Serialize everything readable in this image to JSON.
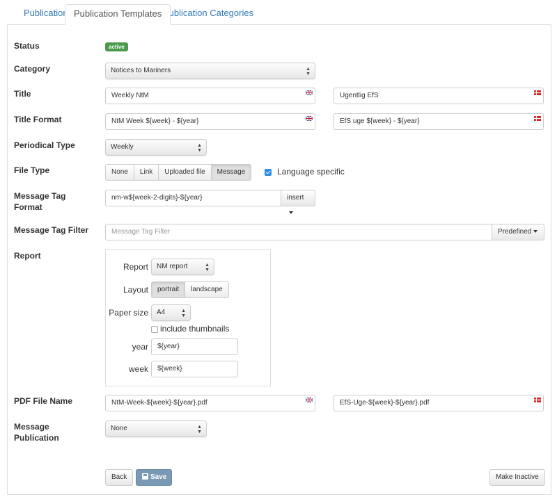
{
  "tabs": [
    {
      "label": "Publications",
      "active": false
    },
    {
      "label": "Publication Templates",
      "active": true
    },
    {
      "label": "Publication Categories",
      "active": false
    }
  ],
  "form": {
    "status": {
      "label": "Status",
      "badge": "active",
      "badge_color": "#4c9a4c"
    },
    "category": {
      "label": "Category",
      "value": "Notices to Mariners"
    },
    "title": {
      "label": "Title",
      "en": "Weekly NtM",
      "da": "Ugentlig EfS"
    },
    "title_format": {
      "label": "Title Format",
      "en": "NtM Week ${week} - ${year}",
      "da": "EfS uge ${week} - ${year}"
    },
    "periodical_type": {
      "label": "Periodical Type",
      "value": "Weekly"
    },
    "file_type": {
      "label": "File Type",
      "options": [
        "None",
        "Link",
        "Uploaded file",
        "Message"
      ],
      "selected": "Message",
      "language_specific_label": "Language specific",
      "language_specific_checked": true
    },
    "message_tag_format": {
      "label_line1": "Message Tag",
      "label_line2": "Format",
      "value": "nm-w${week-2-digits}-${year}",
      "insert_label": "insert"
    },
    "message_tag_filter": {
      "label": "Message Tag Filter",
      "placeholder": "Message Tag Filter",
      "predefined_label": "Predefined"
    },
    "report": {
      "label": "Report",
      "report_label": "Report",
      "report_value": "NM report",
      "layout_label": "Layout",
      "layout_options": [
        "portrait",
        "landscape"
      ],
      "layout_selected": "portrait",
      "paper_size_label": "Paper size",
      "paper_size_value": "A4",
      "thumbnails_label": "include thumbnails",
      "thumbnails_checked": false,
      "year_label": "year",
      "year_value": "${year}",
      "week_label": "week",
      "week_value": "${week}"
    },
    "pdf_file_name": {
      "label": "PDF File Name",
      "en": "NtM-Week-${week}-${year}.pdf",
      "da": "EfS-Uge-${week}-${year}.pdf"
    },
    "message_publication": {
      "label_line1": "Message",
      "label_line2": "Publication",
      "value": "None"
    }
  },
  "actions": {
    "back": "Back",
    "save": "Save",
    "make_inactive": "Make Inactive"
  },
  "icons": {
    "flag_en": "uk-flag-icon",
    "flag_da": "danish-flag-icon",
    "save": "floppy-disk-icon"
  }
}
